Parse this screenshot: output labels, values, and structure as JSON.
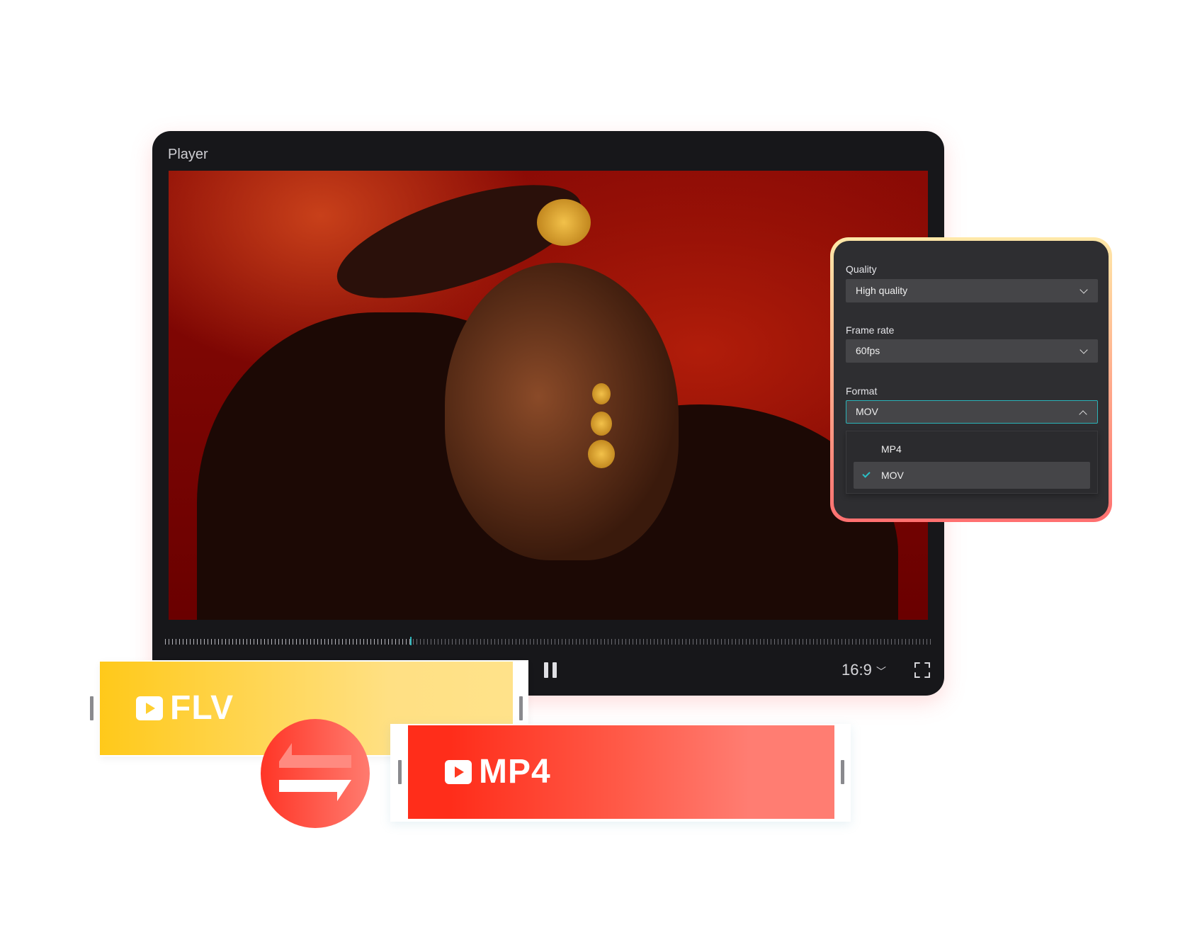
{
  "player": {
    "title": "Player",
    "aspect_ratio": "16:9",
    "playback_progress_percent": 32,
    "state": "playing"
  },
  "settings": {
    "quality_label": "Quality",
    "quality_value": "High quality",
    "framerate_label": "Frame rate",
    "framerate_value": "60fps",
    "format_label": "Format",
    "format_value": "MOV",
    "format_options": [
      {
        "label": "MP4",
        "selected": false
      },
      {
        "label": "MOV",
        "selected": true
      }
    ]
  },
  "clips": {
    "source": "FLV",
    "target": "MP4"
  },
  "colors": {
    "accent": "#2bb3b8",
    "flv": "#ffc91a",
    "mp4": "#ff2d1a",
    "panel_bg": "#2e2e31"
  }
}
